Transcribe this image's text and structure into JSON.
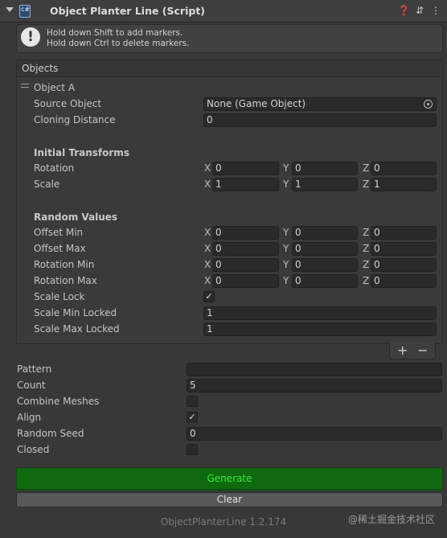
{
  "header": {
    "title": "Object Planter Line (Script)",
    "icons": [
      "help-icon",
      "preset-icon",
      "more-icon"
    ]
  },
  "help": {
    "line1": "Hold down Shift to add markers.",
    "line2": "Hold down Ctrl to delete markers."
  },
  "objects": {
    "header": "Objects",
    "item_name": "Object A",
    "source_object": {
      "label": "Source Object",
      "value": "None (Game Object)"
    },
    "cloning_distance": {
      "label": "Cloning Distance",
      "value": "0"
    },
    "initial_transforms": {
      "heading": "Initial Transforms",
      "rotation": {
        "label": "Rotation",
        "x": "0",
        "y": "0",
        "z": "0"
      },
      "scale": {
        "label": "Scale",
        "x": "1",
        "y": "1",
        "z": "1"
      }
    },
    "random_values": {
      "heading": "Random Values",
      "offset_min": {
        "label": "Offset Min",
        "x": "0",
        "y": "0",
        "z": "0"
      },
      "offset_max": {
        "label": "Offset Max",
        "x": "0",
        "y": "0",
        "z": "0"
      },
      "rotation_min": {
        "label": "Rotation Min",
        "x": "0",
        "y": "0",
        "z": "0"
      },
      "rotation_max": {
        "label": "Rotation Max",
        "x": "0",
        "y": "0",
        "z": "0"
      },
      "scale_lock": {
        "label": "Scale Lock",
        "checked": true
      },
      "scale_min_locked": {
        "label": "Scale Min Locked",
        "value": "1"
      },
      "scale_max_locked": {
        "label": "Scale Max Locked",
        "value": "1"
      }
    },
    "axis_labels": {
      "x": "X",
      "y": "Y",
      "z": "Z"
    },
    "add_symbol": "+",
    "remove_symbol": "−"
  },
  "settings": {
    "pattern": {
      "label": "Pattern",
      "value": ""
    },
    "count": {
      "label": "Count",
      "value": "5"
    },
    "combine_meshes": {
      "label": "Combine Meshes",
      "checked": false
    },
    "align": {
      "label": "Align",
      "checked": true
    },
    "random_seed": {
      "label": "Random Seed",
      "value": "0"
    },
    "closed": {
      "label": "Closed",
      "checked": false
    }
  },
  "buttons": {
    "generate": "Generate",
    "clear": "Clear"
  },
  "footer": {
    "version": "ObjectPlanterLine 1.2.174",
    "watermark": "@稀土掘金技术社区"
  },
  "colors": {
    "background": "#383838",
    "generate_bg": "#0f6a0f",
    "generate_text": "#3de83d"
  }
}
